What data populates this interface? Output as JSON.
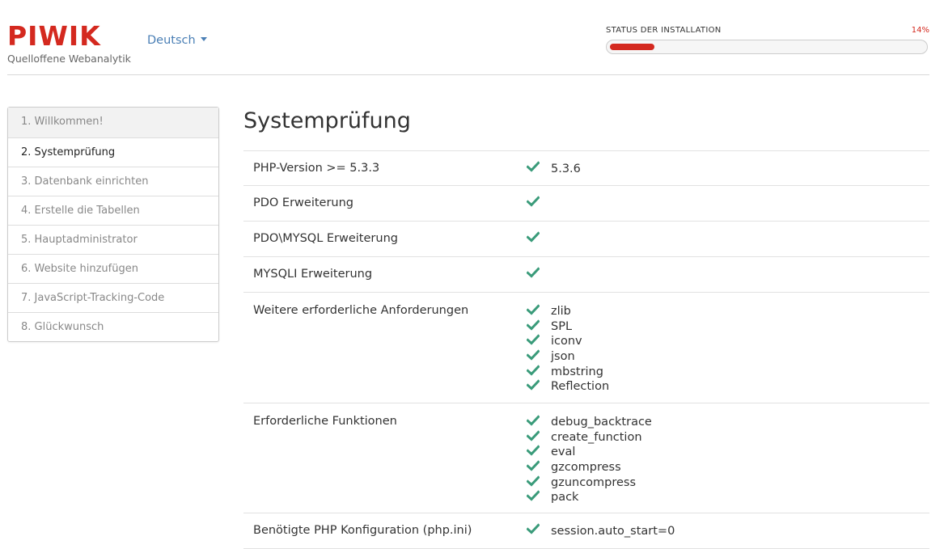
{
  "header": {
    "logo_text": "PIWIK",
    "tagline": "Quelloffene Webanalytik",
    "language": "Deutsch",
    "status_label": "STATUS DER INSTALLATION",
    "progress_percent_label": "14%",
    "progress_fraction": 0.14
  },
  "colors": {
    "brand": "#d4291f",
    "link": "#4a7fb5",
    "check": "#3a9b7a"
  },
  "steps": [
    {
      "label": "1. Willkommen!"
    },
    {
      "label": "2. Systemprüfung",
      "current": true
    },
    {
      "label": "3. Datenbank einrichten"
    },
    {
      "label": "4. Erstelle die Tabellen"
    },
    {
      "label": "5. Hauptadministrator"
    },
    {
      "label": "6. Website hinzufügen"
    },
    {
      "label": "7. JavaScript-Tracking-Code"
    },
    {
      "label": "8. Glückwunsch"
    }
  ],
  "main": {
    "title": "Systemprüfung",
    "rows": [
      {
        "label": "PHP-Version >= 5.3.3",
        "values": [
          "5.3.6"
        ]
      },
      {
        "label": "PDO Erweiterung",
        "values": [
          ""
        ]
      },
      {
        "label": "PDO\\MYSQL Erweiterung",
        "values": [
          ""
        ]
      },
      {
        "label": "MYSQLI Erweiterung",
        "values": [
          ""
        ]
      },
      {
        "label": "Weitere erforderliche Anforderungen",
        "values": [
          "zlib",
          "SPL",
          "iconv",
          "json",
          "mbstring",
          "Reflection"
        ]
      },
      {
        "label": "Erforderliche Funktionen",
        "values": [
          "debug_backtrace",
          "create_function",
          "eval",
          "gzcompress",
          "gzuncompress",
          "pack"
        ]
      },
      {
        "label": "Benötigte PHP Konfiguration (php.ini)",
        "values": [
          "session.auto_start=0"
        ]
      }
    ]
  }
}
